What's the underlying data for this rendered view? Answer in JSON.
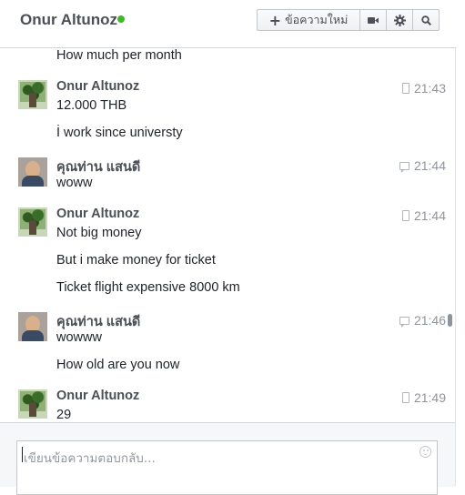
{
  "header": {
    "contact_name": "Onur Altunoz",
    "online_color": "#42b72a",
    "new_message_label": "ข้อความใหม่",
    "icons": [
      "plus-icon",
      "video-camera-icon",
      "gear-icon",
      "search-icon"
    ]
  },
  "messages": {
    "m0": {
      "text": "How much per month"
    },
    "g1": {
      "sender": "Onur Altunoz",
      "time": "21:43",
      "time_icon": "phone-icon",
      "lines": [
        "12.000 THB",
        "İ work since universty"
      ]
    },
    "g2": {
      "sender": "คุณท่าน แสนดี",
      "time": "21:44",
      "time_icon": "chat-icon",
      "lines": [
        "woww"
      ]
    },
    "g3": {
      "sender": "Onur Altunoz",
      "time": "21:44",
      "time_icon": "phone-icon",
      "lines": [
        "Not big money",
        "But i make money for ticket",
        "Ticket flight expensive 8000 km"
      ]
    },
    "g4": {
      "sender": "คุณท่าน แสนดี",
      "time": "21:46",
      "time_icon": "chat-icon",
      "lines": [
        "wowww",
        "How old are you now"
      ]
    },
    "g5": {
      "sender": "Onur Altunoz",
      "time": "21:49",
      "time_icon": "phone-icon",
      "lines": [
        "29"
      ]
    }
  },
  "composer": {
    "placeholder": "เขียนข้อความตอบกลับ..."
  }
}
